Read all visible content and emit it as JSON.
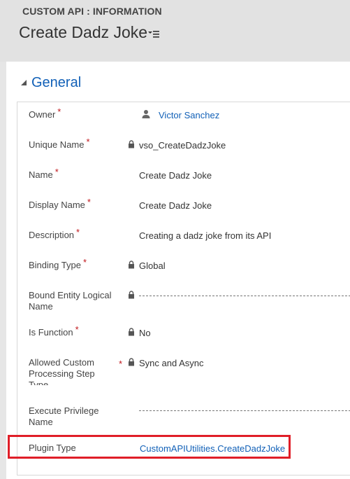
{
  "header": {
    "entity_label": "CUSTOM API : INFORMATION",
    "record_title": "Create Dadz Joke"
  },
  "section": {
    "title": "General"
  },
  "fields": {
    "owner": {
      "label": "Owner",
      "required": "*",
      "value": "Victor Sanchez",
      "icon": "user-icon"
    },
    "unique_name": {
      "label": "Unique Name",
      "required": "*",
      "value": "vso_CreateDadzJoke",
      "locked": true
    },
    "name": {
      "label": "Name",
      "required": "*",
      "value": "Create Dadz Joke"
    },
    "display_name": {
      "label": "Display Name",
      "required": "*",
      "value": "Create Dadz Joke"
    },
    "description": {
      "label": "Description",
      "required": "*",
      "value": "Creating a dadz joke from its API"
    },
    "binding_type": {
      "label": "Binding Type",
      "required": "*",
      "value": "Global",
      "locked": true
    },
    "bound_entity": {
      "label": "Bound Entity Logical Name",
      "value": "",
      "locked": true
    },
    "is_function": {
      "label": "Is Function",
      "required": "*",
      "value": "No",
      "locked": true
    },
    "allowed_processing": {
      "label": "Allowed Custom Processing Step Type",
      "required": "*",
      "value": "Sync and Async",
      "locked": true
    },
    "execute_privilege": {
      "label": "Execute Privilege Name",
      "value": ""
    },
    "plugin_type": {
      "label": "Plugin Type",
      "value": "CustomAPIUtilities.CreateDadzJoke"
    }
  },
  "colors": {
    "link": "#1160b7",
    "required": "#c0161b",
    "highlight": "#e01e28"
  }
}
